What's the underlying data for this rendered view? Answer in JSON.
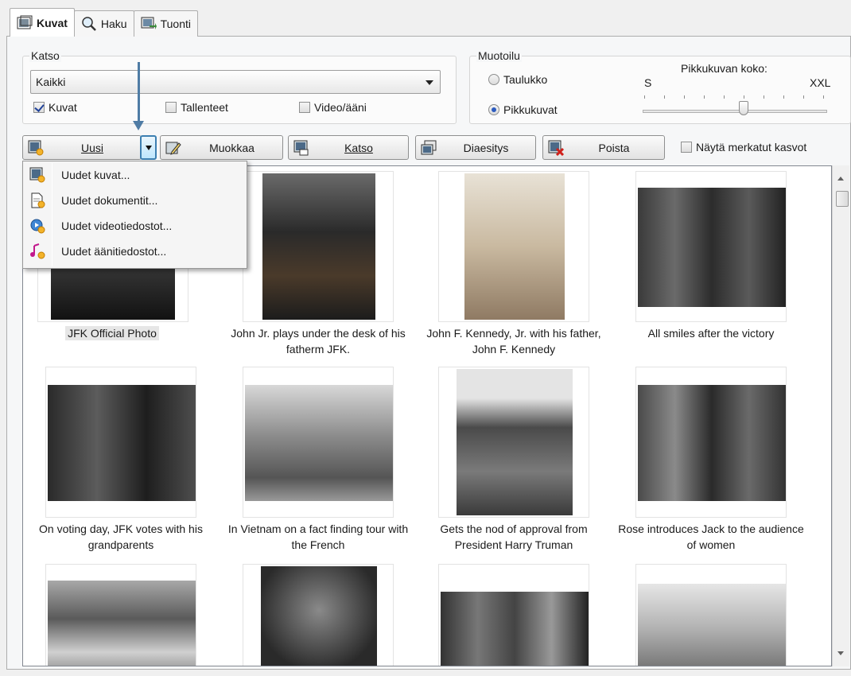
{
  "tabs": [
    {
      "label": "Kuvat",
      "icon": "photos-tab-icon",
      "active": true
    },
    {
      "label": "Haku",
      "icon": "search-icon",
      "active": false
    },
    {
      "label": "Tuonti",
      "icon": "import-icon",
      "active": false
    }
  ],
  "view_group": {
    "title": "Katso",
    "dropdown_value": "Kaikki",
    "checkboxes": [
      {
        "label": "Kuvat",
        "checked": true
      },
      {
        "label": "Tallenteet",
        "checked": false
      },
      {
        "label": "Video/ääni",
        "checked": false
      }
    ]
  },
  "format_group": {
    "title": "Muotoilu",
    "radios": [
      {
        "label": "Taulukko",
        "selected": false
      },
      {
        "label": "Pikkukuvat",
        "selected": true
      }
    ],
    "size_label": "Pikkukuvan koko:",
    "size_min": "S",
    "size_max": "XXL",
    "size_level": 0.55
  },
  "toolbar": {
    "new_label": "Uusi",
    "edit_label": "Muokkaa",
    "view_label": "Katso",
    "slideshow_label": "Diaesitys",
    "delete_label": "Poista",
    "faces_label": "Näytä merkatut kasvot"
  },
  "new_menu": [
    {
      "label": "Uudet kuvat...",
      "icon": "new-image-icon"
    },
    {
      "label": "Uudet dokumentit...",
      "icon": "new-document-icon"
    },
    {
      "label": "Uudet videotiedostot...",
      "icon": "new-video-icon"
    },
    {
      "label": "Uudet äänitiedostot...",
      "icon": "new-audio-icon"
    }
  ],
  "photos": [
    {
      "caption": "JFK Official Photo",
      "selected": true
    },
    {
      "caption": "John Jr. plays under the desk of his fatherm JFK."
    },
    {
      "caption": "John F. Kennedy, Jr. with his father, John F. Kennedy"
    },
    {
      "caption": "All smiles after the victory"
    },
    {
      "caption": "On voting day, JFK votes with his grandparents"
    },
    {
      "caption": "In Vietnam on a fact finding tour with the French"
    },
    {
      "caption": "Gets the nod of approval from President Harry Truman"
    },
    {
      "caption": "Rose introduces Jack to the audience of women"
    },
    {
      "caption": ""
    },
    {
      "caption": ""
    },
    {
      "caption": ""
    },
    {
      "caption": ""
    }
  ],
  "colors": {
    "accent": "#3c7fb1",
    "annotation_arrow": "#4f7ca5"
  }
}
